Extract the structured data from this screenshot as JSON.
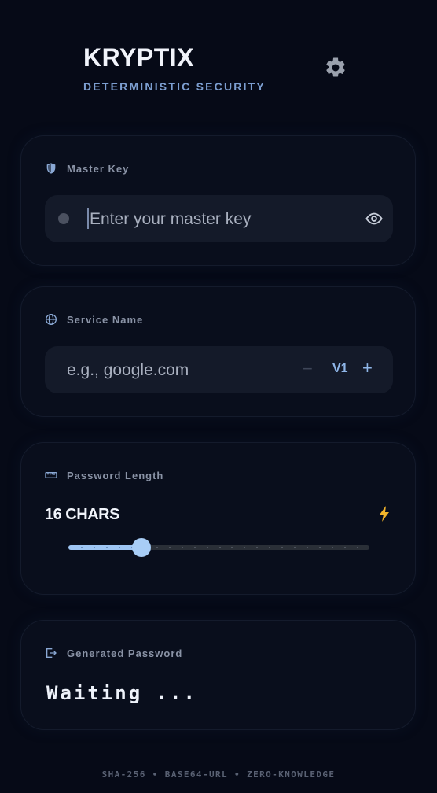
{
  "app": {
    "title": "KRYPTIX",
    "subtitle": "DETERMINISTIC SECURITY",
    "settings_icon": "gear-icon"
  },
  "master_key": {
    "label": "Master Key",
    "icon": "shield-icon",
    "placeholder": "Enter your master key",
    "value": "",
    "toggle_icon": "eye-icon"
  },
  "service": {
    "label": "Service Name",
    "icon": "globe-icon",
    "placeholder": "e.g., google.com",
    "value": "",
    "version_label": "V1",
    "decrement_label": "−",
    "increment_label": "+"
  },
  "length": {
    "label": "Password Length",
    "icon": "ruler-icon",
    "value_label": "16 CHARS",
    "value": 16,
    "min": 8,
    "max": 64,
    "indicator_icon": "bolt-icon"
  },
  "output": {
    "label": "Generated Password",
    "icon": "output-icon",
    "value": "Waiting ..."
  },
  "footer": {
    "text": "SHA-256 • BASE64-URL • ZERO-KNOWLEDGE"
  },
  "colors": {
    "background": "#060a17",
    "accent": "#9ec5f3",
    "bolt": "#f4b52b",
    "muted": "#8a93a6"
  }
}
